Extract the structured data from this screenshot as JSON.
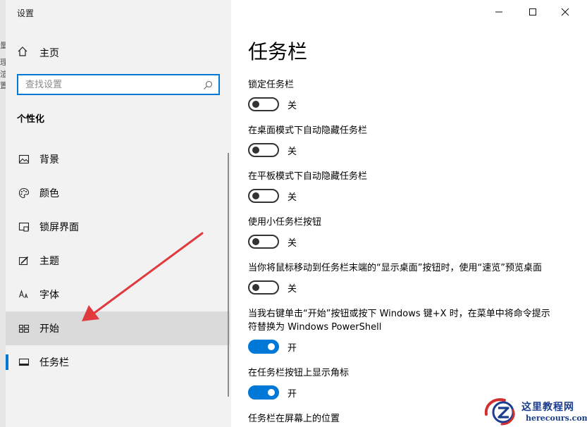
{
  "window": {
    "title": "设置"
  },
  "sidebar": {
    "home_label": "主页",
    "search_placeholder": "查找设置",
    "section_title": "个性化",
    "items": [
      {
        "label": "背景",
        "icon": "picture-icon"
      },
      {
        "label": "颜色",
        "icon": "palette-icon"
      },
      {
        "label": "锁屏界面",
        "icon": "lock-screen-icon"
      },
      {
        "label": "主题",
        "icon": "theme-icon"
      },
      {
        "label": "字体",
        "icon": "font-icon"
      },
      {
        "label": "开始",
        "icon": "start-icon",
        "state": "hover"
      },
      {
        "label": "任务栏",
        "icon": "taskbar-icon",
        "state": "selected"
      }
    ],
    "edge_glyphs": [
      "量",
      "理",
      "渲",
      "置"
    ]
  },
  "main": {
    "title": "任务栏",
    "settings": [
      {
        "label": "锁定任务栏",
        "state": "关",
        "on": false
      },
      {
        "label": "在桌面模式下自动隐藏任务栏",
        "state": "关",
        "on": false
      },
      {
        "label": "在平板模式下自动隐藏任务栏",
        "state": "关",
        "on": false
      },
      {
        "label": "使用小任务栏按钮",
        "state": "关",
        "on": false
      },
      {
        "label": "当你将鼠标移动到任务栏末端的“显示桌面”按钮时，使用“速览”预览桌面",
        "state": "关",
        "on": false
      },
      {
        "label": "当我右键单击“开始”按钮或按下 Windows 键+X 时，在菜单中将命令提示符替换为 Windows PowerShell",
        "state": "开",
        "on": true
      },
      {
        "label": "在任务栏按钮上显示角标",
        "state": "开",
        "on": true
      },
      {
        "label": "任务栏在屏幕上的位置"
      }
    ]
  },
  "watermark": {
    "text": "这里教程网",
    "url": "herecours.com"
  },
  "colors": {
    "accent": "#0078d7",
    "sidebar_bg": "#f2f2f2",
    "hover_bg": "#dadada",
    "annotation_arrow": "#e0393e"
  }
}
